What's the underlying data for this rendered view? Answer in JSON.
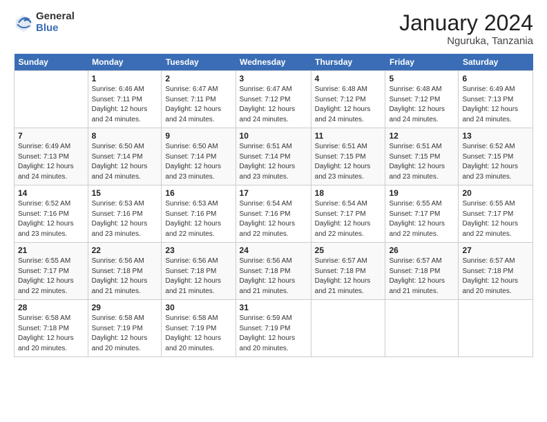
{
  "logo": {
    "general": "General",
    "blue": "Blue"
  },
  "title": "January 2024",
  "location": "Nguruka, Tanzania",
  "days_header": [
    "Sunday",
    "Monday",
    "Tuesday",
    "Wednesday",
    "Thursday",
    "Friday",
    "Saturday"
  ],
  "weeks": [
    [
      {
        "day": "",
        "sunrise": "",
        "sunset": "",
        "daylight": ""
      },
      {
        "day": "1",
        "sunrise": "Sunrise: 6:46 AM",
        "sunset": "Sunset: 7:11 PM",
        "daylight": "Daylight: 12 hours and 24 minutes."
      },
      {
        "day": "2",
        "sunrise": "Sunrise: 6:47 AM",
        "sunset": "Sunset: 7:11 PM",
        "daylight": "Daylight: 12 hours and 24 minutes."
      },
      {
        "day": "3",
        "sunrise": "Sunrise: 6:47 AM",
        "sunset": "Sunset: 7:12 PM",
        "daylight": "Daylight: 12 hours and 24 minutes."
      },
      {
        "day": "4",
        "sunrise": "Sunrise: 6:48 AM",
        "sunset": "Sunset: 7:12 PM",
        "daylight": "Daylight: 12 hours and 24 minutes."
      },
      {
        "day": "5",
        "sunrise": "Sunrise: 6:48 AM",
        "sunset": "Sunset: 7:12 PM",
        "daylight": "Daylight: 12 hours and 24 minutes."
      },
      {
        "day": "6",
        "sunrise": "Sunrise: 6:49 AM",
        "sunset": "Sunset: 7:13 PM",
        "daylight": "Daylight: 12 hours and 24 minutes."
      }
    ],
    [
      {
        "day": "7",
        "sunrise": "Sunrise: 6:49 AM",
        "sunset": "Sunset: 7:13 PM",
        "daylight": "Daylight: 12 hours and 24 minutes."
      },
      {
        "day": "8",
        "sunrise": "Sunrise: 6:50 AM",
        "sunset": "Sunset: 7:14 PM",
        "daylight": "Daylight: 12 hours and 24 minutes."
      },
      {
        "day": "9",
        "sunrise": "Sunrise: 6:50 AM",
        "sunset": "Sunset: 7:14 PM",
        "daylight": "Daylight: 12 hours and 23 minutes."
      },
      {
        "day": "10",
        "sunrise": "Sunrise: 6:51 AM",
        "sunset": "Sunset: 7:14 PM",
        "daylight": "Daylight: 12 hours and 23 minutes."
      },
      {
        "day": "11",
        "sunrise": "Sunrise: 6:51 AM",
        "sunset": "Sunset: 7:15 PM",
        "daylight": "Daylight: 12 hours and 23 minutes."
      },
      {
        "day": "12",
        "sunrise": "Sunrise: 6:51 AM",
        "sunset": "Sunset: 7:15 PM",
        "daylight": "Daylight: 12 hours and 23 minutes."
      },
      {
        "day": "13",
        "sunrise": "Sunrise: 6:52 AM",
        "sunset": "Sunset: 7:15 PM",
        "daylight": "Daylight: 12 hours and 23 minutes."
      }
    ],
    [
      {
        "day": "14",
        "sunrise": "Sunrise: 6:52 AM",
        "sunset": "Sunset: 7:16 PM",
        "daylight": "Daylight: 12 hours and 23 minutes."
      },
      {
        "day": "15",
        "sunrise": "Sunrise: 6:53 AM",
        "sunset": "Sunset: 7:16 PM",
        "daylight": "Daylight: 12 hours and 23 minutes."
      },
      {
        "day": "16",
        "sunrise": "Sunrise: 6:53 AM",
        "sunset": "Sunset: 7:16 PM",
        "daylight": "Daylight: 12 hours and 22 minutes."
      },
      {
        "day": "17",
        "sunrise": "Sunrise: 6:54 AM",
        "sunset": "Sunset: 7:16 PM",
        "daylight": "Daylight: 12 hours and 22 minutes."
      },
      {
        "day": "18",
        "sunrise": "Sunrise: 6:54 AM",
        "sunset": "Sunset: 7:17 PM",
        "daylight": "Daylight: 12 hours and 22 minutes."
      },
      {
        "day": "19",
        "sunrise": "Sunrise: 6:55 AM",
        "sunset": "Sunset: 7:17 PM",
        "daylight": "Daylight: 12 hours and 22 minutes."
      },
      {
        "day": "20",
        "sunrise": "Sunrise: 6:55 AM",
        "sunset": "Sunset: 7:17 PM",
        "daylight": "Daylight: 12 hours and 22 minutes."
      }
    ],
    [
      {
        "day": "21",
        "sunrise": "Sunrise: 6:55 AM",
        "sunset": "Sunset: 7:17 PM",
        "daylight": "Daylight: 12 hours and 22 minutes."
      },
      {
        "day": "22",
        "sunrise": "Sunrise: 6:56 AM",
        "sunset": "Sunset: 7:18 PM",
        "daylight": "Daylight: 12 hours and 21 minutes."
      },
      {
        "day": "23",
        "sunrise": "Sunrise: 6:56 AM",
        "sunset": "Sunset: 7:18 PM",
        "daylight": "Daylight: 12 hours and 21 minutes."
      },
      {
        "day": "24",
        "sunrise": "Sunrise: 6:56 AM",
        "sunset": "Sunset: 7:18 PM",
        "daylight": "Daylight: 12 hours and 21 minutes."
      },
      {
        "day": "25",
        "sunrise": "Sunrise: 6:57 AM",
        "sunset": "Sunset: 7:18 PM",
        "daylight": "Daylight: 12 hours and 21 minutes."
      },
      {
        "day": "26",
        "sunrise": "Sunrise: 6:57 AM",
        "sunset": "Sunset: 7:18 PM",
        "daylight": "Daylight: 12 hours and 21 minutes."
      },
      {
        "day": "27",
        "sunrise": "Sunrise: 6:57 AM",
        "sunset": "Sunset: 7:18 PM",
        "daylight": "Daylight: 12 hours and 20 minutes."
      }
    ],
    [
      {
        "day": "28",
        "sunrise": "Sunrise: 6:58 AM",
        "sunset": "Sunset: 7:18 PM",
        "daylight": "Daylight: 12 hours and 20 minutes."
      },
      {
        "day": "29",
        "sunrise": "Sunrise: 6:58 AM",
        "sunset": "Sunset: 7:19 PM",
        "daylight": "Daylight: 12 hours and 20 minutes."
      },
      {
        "day": "30",
        "sunrise": "Sunrise: 6:58 AM",
        "sunset": "Sunset: 7:19 PM",
        "daylight": "Daylight: 12 hours and 20 minutes."
      },
      {
        "day": "31",
        "sunrise": "Sunrise: 6:59 AM",
        "sunset": "Sunset: 7:19 PM",
        "daylight": "Daylight: 12 hours and 20 minutes."
      },
      {
        "day": "",
        "sunrise": "",
        "sunset": "",
        "daylight": ""
      },
      {
        "day": "",
        "sunrise": "",
        "sunset": "",
        "daylight": ""
      },
      {
        "day": "",
        "sunrise": "",
        "sunset": "",
        "daylight": ""
      }
    ]
  ]
}
